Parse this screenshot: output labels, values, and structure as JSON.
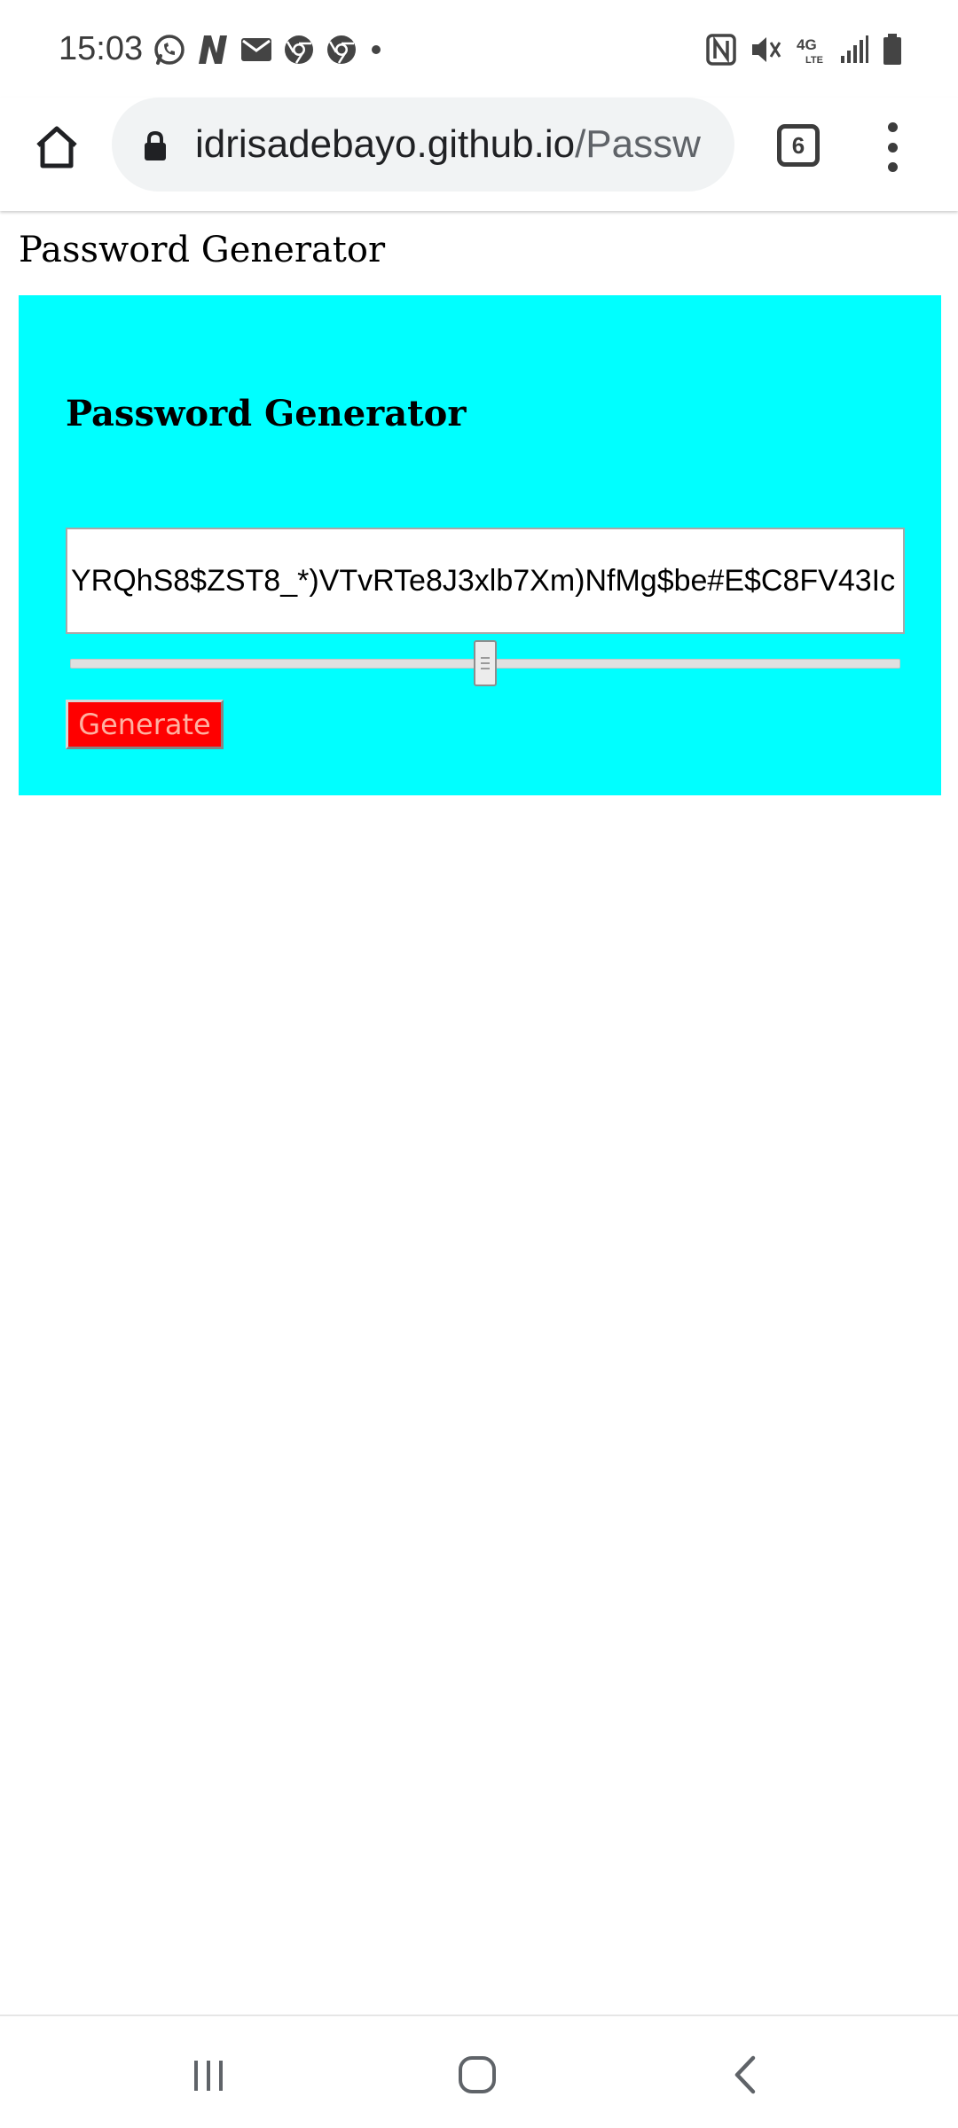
{
  "status_bar": {
    "time": "15:03",
    "left_icons": [
      "whatsapp-icon",
      "n-app-icon",
      "mail-icon",
      "chrome-icon",
      "chrome-icon",
      "notification-dot-icon"
    ],
    "right_icons": [
      "nfc-icon",
      "vibrate-icon",
      "4g-lte-icon",
      "signal-icon",
      "battery-icon"
    ],
    "network_label": "4G LTE"
  },
  "browser": {
    "url_host": "idrisadebayo.github.io",
    "url_path": "/Passw",
    "tab_count": "6"
  },
  "page": {
    "heading": "Password Generator",
    "card": {
      "title": "Password Generator",
      "password_value": "YRQhS8$ZST8_*)VTvRTe8J3xlb7Xm)NfMg$be#E$C8FV43Ic",
      "slider_fraction": 0.5,
      "generate_label": "Generate"
    }
  },
  "colors": {
    "card_background": "#00ffff",
    "button_background": "#ff0000",
    "button_text": "#ffb0a0"
  },
  "nav_bar": {
    "items": [
      "recent-apps-icon",
      "home-icon",
      "back-icon"
    ]
  }
}
